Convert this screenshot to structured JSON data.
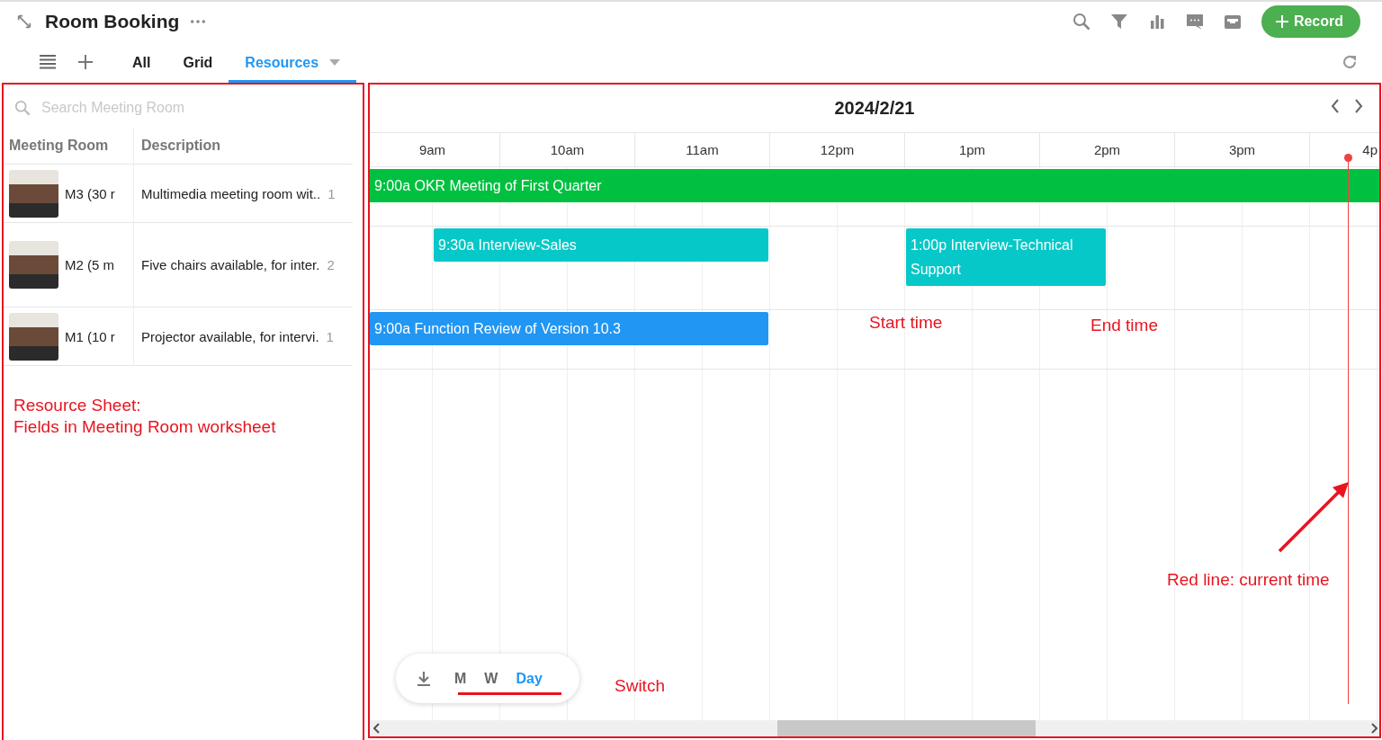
{
  "app": {
    "title": "Room Booking"
  },
  "toolbar": {
    "record_button": "Record"
  },
  "views": [
    {
      "label": "All",
      "selected": false
    },
    {
      "label": "Grid",
      "selected": false
    },
    {
      "label": "Resources",
      "selected": true
    }
  ],
  "resources": {
    "search": {
      "placeholder": "Search Meeting Room"
    },
    "columns": [
      "Meeting Room",
      "Description"
    ],
    "rows": [
      {
        "name": "M3 (30 r",
        "description": "Multimedia meeting room wit..",
        "count": "1"
      },
      {
        "name": "M2 (5 m",
        "description": "Five chairs available, for inter.",
        "count": "2"
      },
      {
        "name": "M1 (10 r",
        "description": "Projector available, for intervi.",
        "count": "1"
      }
    ]
  },
  "calendar": {
    "date": "2024/2/21",
    "hours": [
      "9am",
      "10am",
      "11am",
      "12pm",
      "1pm",
      "2pm",
      "3pm",
      "4p"
    ],
    "lanes": [
      {
        "events": [
          {
            "label": "9:00a OKR Meeting of First Quarter",
            "color": "#00c040"
          }
        ]
      },
      {
        "events": [
          {
            "label": "9:30a Interview-Sales",
            "color": "#06c8c8"
          },
          {
            "label": "1:00p Interview-Technical Support",
            "color": "#06c8c8"
          }
        ]
      },
      {
        "events": [
          {
            "label": "9:00a Function Review of Version 10.3",
            "color": "#2196f3"
          }
        ]
      }
    ]
  },
  "switcher": {
    "options": [
      {
        "label": "M",
        "selected": false
      },
      {
        "label": "W",
        "selected": false
      },
      {
        "label": "Day",
        "selected": true
      }
    ]
  },
  "annotations": [
    {
      "kind": "panel-title",
      "text": "Resource Sheet:"
    },
    {
      "kind": "panel-body",
      "text": "Fields in Meeting Room worksheet"
    },
    {
      "kind": "start",
      "text": "Start time"
    },
    {
      "kind": "end",
      "text": "End time"
    },
    {
      "kind": "now",
      "text": "Red line: current time"
    },
    {
      "kind": "switch",
      "text": "Switch"
    }
  ]
}
